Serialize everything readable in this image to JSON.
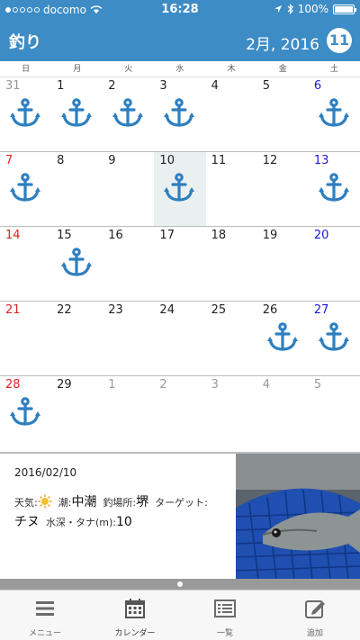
{
  "status_bar": {
    "carrier": "docomo",
    "time": "16:28",
    "battery": "100%",
    "battery_level": 1.0
  },
  "header": {
    "title": "釣り",
    "month": "2月, 2016",
    "today_button": "11"
  },
  "weekdays": [
    "日",
    "月",
    "火",
    "水",
    "木",
    "金",
    "土"
  ],
  "weeks": [
    [
      {
        "day": "31",
        "kind": "other",
        "anchor": true
      },
      {
        "day": "1",
        "kind": "normal",
        "anchor": true
      },
      {
        "day": "2",
        "kind": "normal",
        "anchor": true
      },
      {
        "day": "3",
        "kind": "normal",
        "anchor": true
      },
      {
        "day": "4",
        "kind": "normal",
        "anchor": false
      },
      {
        "day": "5",
        "kind": "normal",
        "anchor": false
      },
      {
        "day": "6",
        "kind": "sat",
        "anchor": true
      }
    ],
    [
      {
        "day": "7",
        "kind": "sun",
        "anchor": true
      },
      {
        "day": "8",
        "kind": "normal",
        "anchor": false
      },
      {
        "day": "9",
        "kind": "normal",
        "anchor": false
      },
      {
        "day": "10",
        "kind": "normal",
        "anchor": true,
        "selected": true
      },
      {
        "day": "11",
        "kind": "normal",
        "anchor": false
      },
      {
        "day": "12",
        "kind": "normal",
        "anchor": false
      },
      {
        "day": "13",
        "kind": "sat",
        "anchor": true
      }
    ],
    [
      {
        "day": "14",
        "kind": "sun",
        "anchor": false
      },
      {
        "day": "15",
        "kind": "normal",
        "anchor": true
      },
      {
        "day": "16",
        "kind": "normal",
        "anchor": false
      },
      {
        "day": "17",
        "kind": "normal",
        "anchor": false
      },
      {
        "day": "18",
        "kind": "normal",
        "anchor": false
      },
      {
        "day": "19",
        "kind": "normal",
        "anchor": false
      },
      {
        "day": "20",
        "kind": "sat",
        "anchor": false
      }
    ],
    [
      {
        "day": "21",
        "kind": "sun",
        "anchor": false
      },
      {
        "day": "22",
        "kind": "normal",
        "anchor": false
      },
      {
        "day": "23",
        "kind": "normal",
        "anchor": false
      },
      {
        "day": "24",
        "kind": "normal",
        "anchor": false
      },
      {
        "day": "25",
        "kind": "normal",
        "anchor": false
      },
      {
        "day": "26",
        "kind": "normal",
        "anchor": true
      },
      {
        "day": "27",
        "kind": "sat",
        "anchor": true
      }
    ],
    [
      {
        "day": "28",
        "kind": "sun",
        "anchor": true
      },
      {
        "day": "29",
        "kind": "normal",
        "anchor": false
      },
      {
        "day": "1",
        "kind": "other",
        "anchor": false
      },
      {
        "day": "2",
        "kind": "other",
        "anchor": false
      },
      {
        "day": "3",
        "kind": "other",
        "anchor": false
      },
      {
        "day": "4",
        "kind": "other",
        "anchor": false
      },
      {
        "day": "5",
        "kind": "other",
        "anchor": false
      }
    ]
  ],
  "detail": {
    "date": "2016/02/10",
    "weather_label": "天気:",
    "weather_icon": "sun-icon",
    "tide_label": "潮:",
    "tide_value": "中潮",
    "spot_label": "釣場所:",
    "spot_value": "堺",
    "target_label": "ターゲット:",
    "target_value": "チヌ",
    "depth_label": "水深・タナ(m):",
    "depth_value": "10"
  },
  "tabs": [
    {
      "label": "メニュー",
      "icon": "menu-icon"
    },
    {
      "label": "カレンダー",
      "icon": "calendar-icon",
      "active": true
    },
    {
      "label": "一覧",
      "icon": "list-icon"
    },
    {
      "label": "追加",
      "icon": "edit-icon"
    }
  ],
  "colors": {
    "header": "#3d8cc6",
    "anchor": "#2e7fc0",
    "sunday": "#e02424",
    "saturday": "#1a1ad8",
    "selected_cell": "#eaf0f0"
  }
}
